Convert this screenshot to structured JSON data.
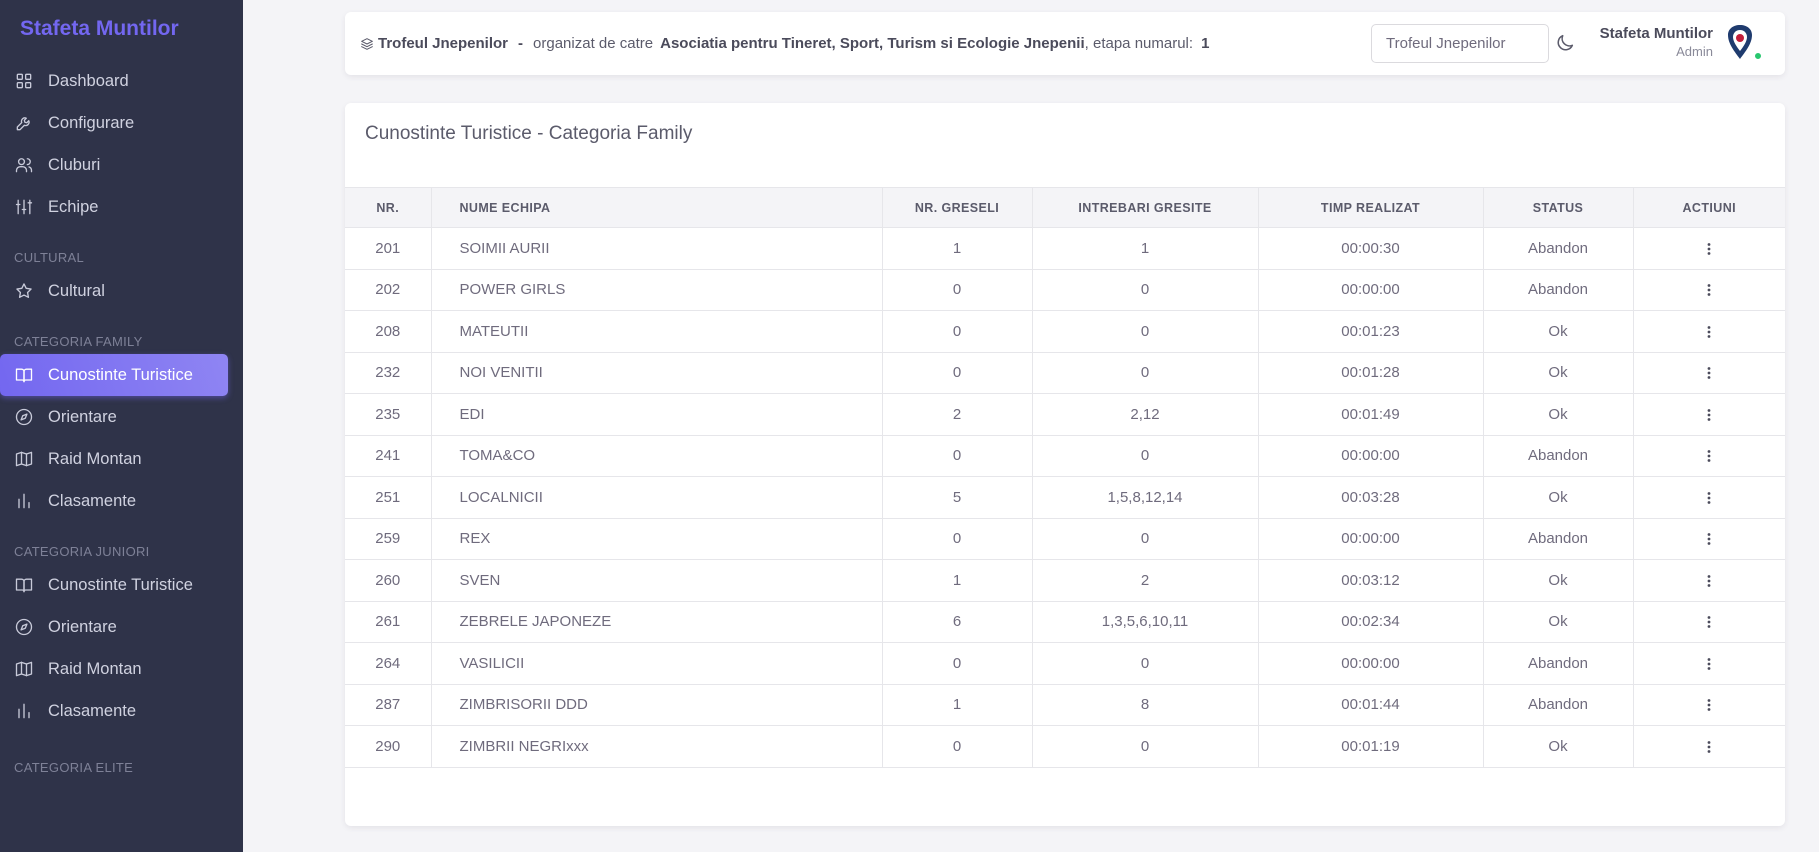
{
  "sidebar": {
    "brand": "Stafeta Muntilor",
    "main": [
      {
        "label": "Dashboard",
        "icon": "dashboard-icon"
      },
      {
        "label": "Configurare",
        "icon": "wrench-icon"
      },
      {
        "label": "Cluburi",
        "icon": "users-icon"
      },
      {
        "label": "Echipe",
        "icon": "sliders-icon"
      }
    ],
    "cultural": {
      "title": "CULTURAL",
      "items": [
        {
          "label": "Cultural",
          "icon": "star-icon"
        }
      ]
    },
    "family": {
      "title": "CATEGORIA FAMILY",
      "items": [
        {
          "label": "Cunostinte Turistice",
          "icon": "book-icon"
        },
        {
          "label": "Orientare",
          "icon": "compass-icon"
        },
        {
          "label": "Raid Montan",
          "icon": "map-icon"
        },
        {
          "label": "Clasamente",
          "icon": "chart-icon"
        }
      ]
    },
    "juniori": {
      "title": "CATEGORIA JUNIORI",
      "items": [
        {
          "label": "Cunostinte Turistice",
          "icon": "book-icon"
        },
        {
          "label": "Orientare",
          "icon": "compass-icon"
        },
        {
          "label": "Raid Montan",
          "icon": "map-icon"
        },
        {
          "label": "Clasamente",
          "icon": "chart-icon"
        }
      ]
    },
    "elite": {
      "title": "CATEGORIA ELITE"
    }
  },
  "topbar": {
    "trophy": "Trofeul Jnepenilor",
    "dash": "-",
    "organized_by": "organizat de catre",
    "organizer": "Asociatia pentru Tineret, Sport, Turism si Ecologie Jnepenii",
    "stage_label": ", etapa numarul:",
    "stage": "1",
    "search_value": "Trofeul Jnepenilor",
    "user_name": "Stafeta Muntilor",
    "user_role": "Admin"
  },
  "card": {
    "title": "Cunostinte Turistice - Categoria Family",
    "columns": [
      "NR.",
      "NUME ECHIPA",
      "NR. GRESELI",
      "INTREBARI GRESITE",
      "TIMP REALIZAT",
      "STATUS",
      "ACTIUNI"
    ],
    "rows": [
      {
        "nr": "201",
        "name": "SOIMII AURII",
        "errors": "1",
        "questions": "1",
        "time": "00:00:30",
        "status": "Abandon"
      },
      {
        "nr": "202",
        "name": "POWER GIRLS",
        "errors": "0",
        "questions": "0",
        "time": "00:00:00",
        "status": "Abandon"
      },
      {
        "nr": "208",
        "name": "MATEUTII",
        "errors": "0",
        "questions": "0",
        "time": "00:01:23",
        "status": "Ok"
      },
      {
        "nr": "232",
        "name": "NOI VENITII",
        "errors": "0",
        "questions": "0",
        "time": "00:01:28",
        "status": "Ok"
      },
      {
        "nr": "235",
        "name": "EDI",
        "errors": "2",
        "questions": "2,12",
        "time": "00:01:49",
        "status": "Ok"
      },
      {
        "nr": "241",
        "name": "TOMA&CO",
        "errors": "0",
        "questions": "0",
        "time": "00:00:00",
        "status": "Abandon"
      },
      {
        "nr": "251",
        "name": "LOCALNICII",
        "errors": "5",
        "questions": "1,5,8,12,14",
        "time": "00:03:28",
        "status": "Ok"
      },
      {
        "nr": "259",
        "name": "REX",
        "errors": "0",
        "questions": "0",
        "time": "00:00:00",
        "status": "Abandon"
      },
      {
        "nr": "260",
        "name": "SVEN",
        "errors": "1",
        "questions": "2",
        "time": "00:03:12",
        "status": "Ok"
      },
      {
        "nr": "261",
        "name": "ZEBRELE JAPONEZE",
        "errors": "6",
        "questions": "1,3,5,6,10,11",
        "time": "00:02:34",
        "status": "Ok"
      },
      {
        "nr": "264",
        "name": "VASILICII",
        "errors": "0",
        "questions": "0",
        "time": "00:00:00",
        "status": "Abandon"
      },
      {
        "nr": "287",
        "name": "ZIMBRISORII DDD",
        "errors": "1",
        "questions": "8",
        "time": "00:01:44",
        "status": "Abandon"
      },
      {
        "nr": "290",
        "name": "ZIMBRII NEGRIxxx",
        "errors": "0",
        "questions": "0",
        "time": "00:01:19",
        "status": "Ok"
      }
    ]
  }
}
